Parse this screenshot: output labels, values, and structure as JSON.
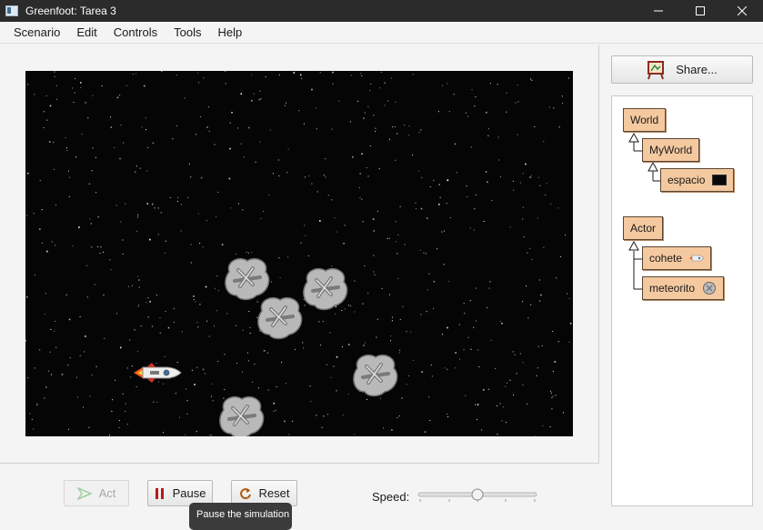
{
  "window": {
    "title": "Greenfoot: Tarea 3"
  },
  "menu": {
    "items": [
      "Scenario",
      "Edit",
      "Controls",
      "Tools",
      "Help"
    ]
  },
  "controls": {
    "act_label": "Act",
    "pause_label": "Pause",
    "reset_label": "Reset",
    "speed_label": "Speed:",
    "speed_value": 0.5,
    "tooltip": "Pause the simulation"
  },
  "share": {
    "label": "Share..."
  },
  "classes": {
    "world": "World",
    "myworld": "MyWorld",
    "espacio": "espacio",
    "actor": "Actor",
    "cohete": "cohete",
    "meteorito": "meteorito"
  },
  "colors": {
    "class_fill": "#f5c9a0",
    "world_background": "#050505",
    "titlebar": "#2b2b2b"
  },
  "icons": {
    "act": "play-arrow-icon",
    "pause": "pause-icon",
    "reset": "reset-icon",
    "share": "easel-icon"
  }
}
